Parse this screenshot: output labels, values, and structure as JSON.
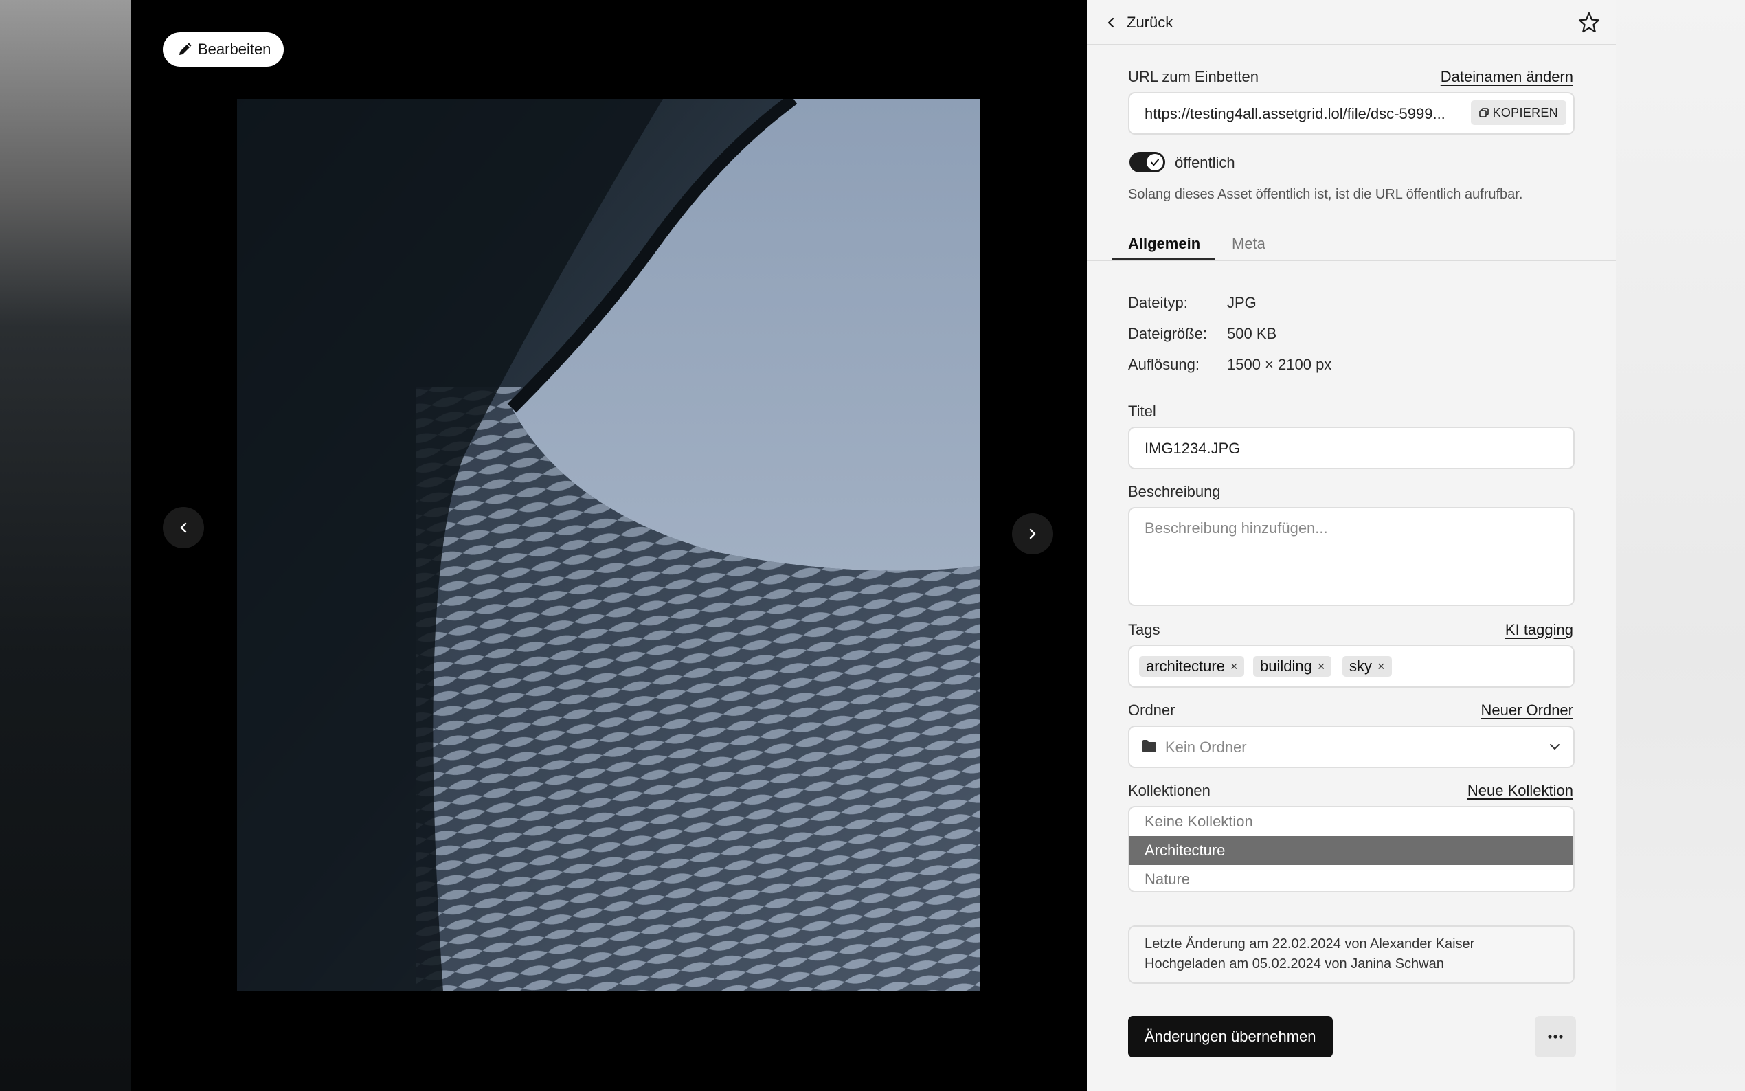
{
  "viewer": {
    "edit_label": "Bearbeiten"
  },
  "panel": {
    "back_label": "Zurück",
    "embed": {
      "label": "URL zum Einbetten",
      "rename_link": "Dateinamen ändern",
      "url": "https://testing4all.assetgrid.lol/file/dsc-5999...",
      "copy_label": "KOPIEREN"
    },
    "visibility": {
      "toggle_label": "öffentlich",
      "toggle_on": true,
      "help_text": "Solang dieses Asset öffentlich ist, ist die URL öffentlich aufrufbar."
    },
    "tabs": [
      {
        "label": "Allgemein",
        "active": true
      },
      {
        "label": "Meta",
        "active": false
      }
    ],
    "info": [
      {
        "key": "Dateityp:",
        "value": "JPG"
      },
      {
        "key": "Dateigröße:",
        "value": "500 KB"
      },
      {
        "key": "Auflösung:",
        "value": "1500 × 2100 px"
      }
    ],
    "title_field": {
      "label": "Titel",
      "value": "IMG1234.JPG"
    },
    "description_field": {
      "label": "Beschreibung",
      "placeholder": "Beschreibung hinzufügen..."
    },
    "tags": {
      "label": "Tags",
      "ai_link": "KI tagging",
      "items": [
        "architecture",
        "building",
        "sky"
      ],
      "remove_glyph": "×"
    },
    "folder": {
      "label": "Ordner",
      "new_link": "Neuer Ordner",
      "value": "Kein Ordner"
    },
    "collections": {
      "label": "Kollektionen",
      "new_link": "Neue Kollektion",
      "options": [
        "Keine Kollektion",
        "Architecture",
        "Nature"
      ],
      "selected": "Architecture"
    },
    "history": {
      "modified": "Letzte Änderung am 22.02.2024 von Alexander Kaiser",
      "uploaded": "Hochgeladen am 05.02.2024 von Janina Schwan"
    },
    "apply_label": "Änderungen übernehmen"
  },
  "colors": {
    "panel_bg": "#f4f4f4",
    "primary_button": "#111111",
    "selected_option": "#6e6e6e",
    "sky": "#9aaabf"
  },
  "icons": [
    "pencil-icon",
    "chevron-left-icon",
    "chevron-right-icon",
    "star-icon",
    "copy-icon",
    "check-icon",
    "folder-icon",
    "chevron-down-icon",
    "more-horizontal-icon"
  ]
}
